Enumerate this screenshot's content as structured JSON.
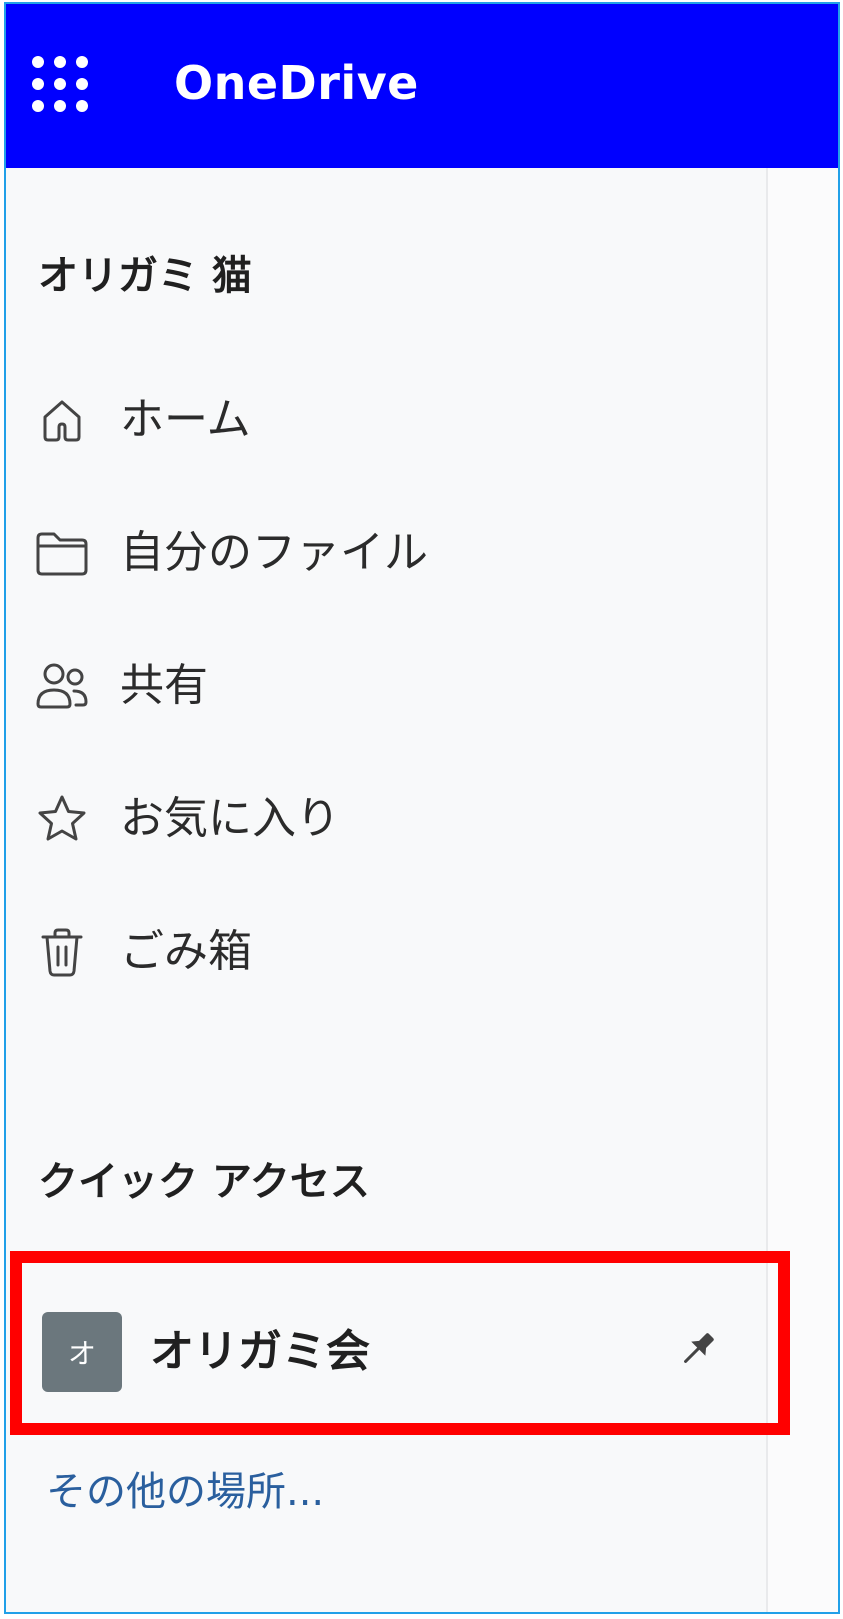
{
  "header": {
    "app_title": "OneDrive",
    "waffle_icon": "waffle-icon",
    "background": "#0000ff"
  },
  "sidebar": {
    "account_name": "オリガミ 猫",
    "items": [
      {
        "label": "ホーム",
        "icon": "home-icon"
      },
      {
        "label": "自分のファイル",
        "icon": "folder-icon"
      },
      {
        "label": "共有",
        "icon": "people-icon"
      },
      {
        "label": "お気に入り",
        "icon": "star-icon"
      },
      {
        "label": "ごみ箱",
        "icon": "trash-icon"
      }
    ],
    "quick_access": {
      "heading": "クイック アクセス",
      "items": [
        {
          "avatar_initial": "オ",
          "label": "オリガミ会",
          "pin_icon": "pin-icon",
          "highlight_color": "#ff0000"
        }
      ],
      "more_link": "その他の場所..."
    }
  }
}
